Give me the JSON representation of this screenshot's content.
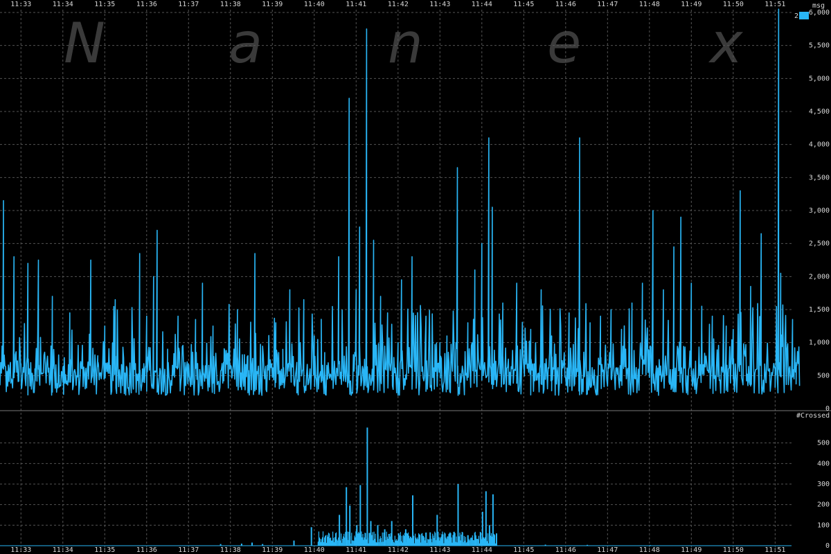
{
  "watermark": [
    "N",
    "a",
    "n",
    "e",
    "x"
  ],
  "colors": {
    "background": "#000000",
    "series": "#29b6f6",
    "grid": "#555555",
    "text": "#d8d8d8"
  },
  "legend": {
    "label": "2",
    "placement": "top-right"
  },
  "chart_data": [
    {
      "type": "line",
      "ylabel": "msg",
      "ylim": [
        0,
        6000
      ],
      "yticks": [
        0,
        500,
        1000,
        1500,
        2000,
        2500,
        3000,
        3500,
        4000,
        4500,
        5000,
        5500,
        6000
      ],
      "ytick_labels": [
        "0",
        "500",
        "1,000",
        "1,500",
        "2,000",
        "2,500",
        "3,000",
        "3,500",
        "4,000",
        "4,500",
        "5,000",
        "5,500",
        "6,000"
      ],
      "xlim": [
        "11:32:30",
        "11:52:20"
      ],
      "xtick_labels": [
        "11:33",
        "11:34",
        "11:35",
        "11:36",
        "11:37",
        "11:38",
        "11:39",
        "11:40",
        "11:41",
        "11:42",
        "11:43",
        "11:44",
        "11:45",
        "11:46",
        "11:47",
        "11:48",
        "11:49",
        "11:50",
        "11:51"
      ],
      "grid": true,
      "series": [
        {
          "points": [
            [
              "11:32:35",
              3150
            ],
            [
              "11:32:45",
              700
            ],
            [
              "11:32:50",
              2300
            ],
            [
              "11:33:00",
              550
            ],
            [
              "11:33:10",
              2200
            ],
            [
              "11:33:20",
              450
            ],
            [
              "11:33:25",
              2250
            ],
            [
              "11:33:35",
              650
            ],
            [
              "11:33:45",
              1700
            ],
            [
              "11:34:00",
              400
            ],
            [
              "11:34:10",
              1450
            ],
            [
              "11:34:25",
              550
            ],
            [
              "11:34:40",
              2250
            ],
            [
              "11:34:50",
              800
            ],
            [
              "11:35:00",
              1250
            ],
            [
              "11:35:15",
              1650
            ],
            [
              "11:35:25",
              450
            ],
            [
              "11:35:40",
              900
            ],
            [
              "11:35:50",
              2350
            ],
            [
              "11:36:00",
              1400
            ],
            [
              "11:36:10",
              2000
            ],
            [
              "11:36:15",
              2700
            ],
            [
              "11:36:30",
              900
            ],
            [
              "11:36:45",
              1400
            ],
            [
              "11:37:00",
              650
            ],
            [
              "11:37:10",
              1350
            ],
            [
              "11:37:20",
              1900
            ],
            [
              "11:37:35",
              1250
            ],
            [
              "11:37:50",
              700
            ],
            [
              "11:38:10",
              1500
            ],
            [
              "11:38:25",
              800
            ],
            [
              "11:38:35",
              2350
            ],
            [
              "11:38:50",
              600
            ],
            [
              "11:39:05",
              1300
            ],
            [
              "11:39:15",
              500
            ],
            [
              "11:39:25",
              1800
            ],
            [
              "11:39:35",
              700
            ],
            [
              "11:39:45",
              1650
            ],
            [
              "11:40:00",
              1100
            ],
            [
              "11:40:10",
              400
            ],
            [
              "11:40:15",
              850
            ],
            [
              "11:40:35",
              2300
            ],
            [
              "11:40:50",
              4700
            ],
            [
              "11:41:00",
              1800
            ],
            [
              "11:41:05",
              2750
            ],
            [
              "11:41:15",
              5750
            ],
            [
              "11:41:25",
              2550
            ],
            [
              "11:41:35",
              1700
            ],
            [
              "11:41:45",
              1450
            ],
            [
              "11:42:00",
              1000
            ],
            [
              "11:42:05",
              1950
            ],
            [
              "11:42:20",
              2300
            ],
            [
              "11:42:40",
              1400
            ],
            [
              "11:43:00",
              1000
            ],
            [
              "11:43:10",
              1100
            ],
            [
              "11:43:25",
              3650
            ],
            [
              "11:43:40",
              1300
            ],
            [
              "11:43:50",
              2100
            ],
            [
              "11:44:00",
              2500
            ],
            [
              "11:44:10",
              4100
            ],
            [
              "11:44:15",
              3050
            ],
            [
              "11:44:30",
              1600
            ],
            [
              "11:44:50",
              1900
            ],
            [
              "11:45:10",
              1200
            ],
            [
              "11:45:25",
              1800
            ],
            [
              "11:45:40",
              1100
            ],
            [
              "11:46:05",
              1450
            ],
            [
              "11:46:20",
              4100
            ],
            [
              "11:46:35",
              1300
            ],
            [
              "11:46:50",
              1400
            ],
            [
              "11:47:05",
              1500
            ],
            [
              "11:47:20",
              1200
            ],
            [
              "11:47:35",
              1600
            ],
            [
              "11:47:50",
              1900
            ],
            [
              "11:48:05",
              3000
            ],
            [
              "11:48:20",
              1800
            ],
            [
              "11:48:35",
              2450
            ],
            [
              "11:48:45",
              2900
            ],
            [
              "11:49:00",
              1900
            ],
            [
              "11:49:15",
              1550
            ],
            [
              "11:49:30",
              1400
            ],
            [
              "11:49:50",
              1250
            ],
            [
              "11:50:00",
              1200
            ],
            [
              "11:50:10",
              3300
            ],
            [
              "11:50:25",
              1850
            ],
            [
              "11:50:40",
              2650
            ],
            [
              "11:51:00",
              600
            ],
            [
              "11:51:05",
              6050
            ],
            [
              "11:51:08",
              2050
            ],
            [
              "11:51:15",
              1400
            ],
            [
              "11:51:25",
              1350
            ],
            [
              "11:51:30",
              650
            ]
          ]
        }
      ]
    },
    {
      "type": "bar",
      "ylabel": "#Crossed",
      "ylim": [
        0,
        600
      ],
      "yticks": [
        0,
        100,
        200,
        300,
        400,
        500
      ],
      "ytick_labels": [
        "0",
        "100",
        "200",
        "300",
        "400",
        "500"
      ],
      "xlim": [
        "11:32:30",
        "11:52:20"
      ],
      "xtick_labels": [
        "11:33",
        "11:34",
        "11:35",
        "11:36",
        "11:37",
        "11:38",
        "11:39",
        "11:40",
        "11:41",
        "11:42",
        "11:43",
        "11:44",
        "11:45",
        "11:46",
        "11:47",
        "11:48",
        "11:49",
        "11:50",
        "11:51"
      ],
      "grid": true,
      "series": [
        {
          "points": [
            [
              "11:37:45",
              8
            ],
            [
              "11:38:15",
              10
            ],
            [
              "11:38:30",
              15
            ],
            [
              "11:38:45",
              8
            ],
            [
              "11:39:30",
              25
            ],
            [
              "11:39:55",
              90
            ],
            [
              "11:40:05",
              15
            ],
            [
              "11:40:15",
              35
            ],
            [
              "11:40:35",
              150
            ],
            [
              "11:40:45",
              285
            ],
            [
              "11:40:50",
              195
            ],
            [
              "11:41:00",
              100
            ],
            [
              "11:41:05",
              295
            ],
            [
              "11:41:15",
              575
            ],
            [
              "11:41:20",
              120
            ],
            [
              "11:41:30",
              100
            ],
            [
              "11:41:40",
              80
            ],
            [
              "11:41:50",
              120
            ],
            [
              "11:42:00",
              60
            ],
            [
              "11:42:10",
              80
            ],
            [
              "11:42:20",
              245
            ],
            [
              "11:42:30",
              55
            ],
            [
              "11:42:45",
              65
            ],
            [
              "11:42:55",
              150
            ],
            [
              "11:43:00",
              35
            ],
            [
              "11:43:10",
              45
            ],
            [
              "11:43:25",
              300
            ],
            [
              "11:43:40",
              25
            ],
            [
              "11:43:50",
              40
            ],
            [
              "11:44:00",
              165
            ],
            [
              "11:44:05",
              265
            ],
            [
              "11:44:10",
              100
            ],
            [
              "11:44:15",
              250
            ],
            [
              "11:44:20",
              60
            ],
            [
              "11:45:30",
              5
            ],
            [
              "11:46:30",
              4
            ],
            [
              "11:48:00",
              3
            ]
          ]
        }
      ]
    }
  ]
}
